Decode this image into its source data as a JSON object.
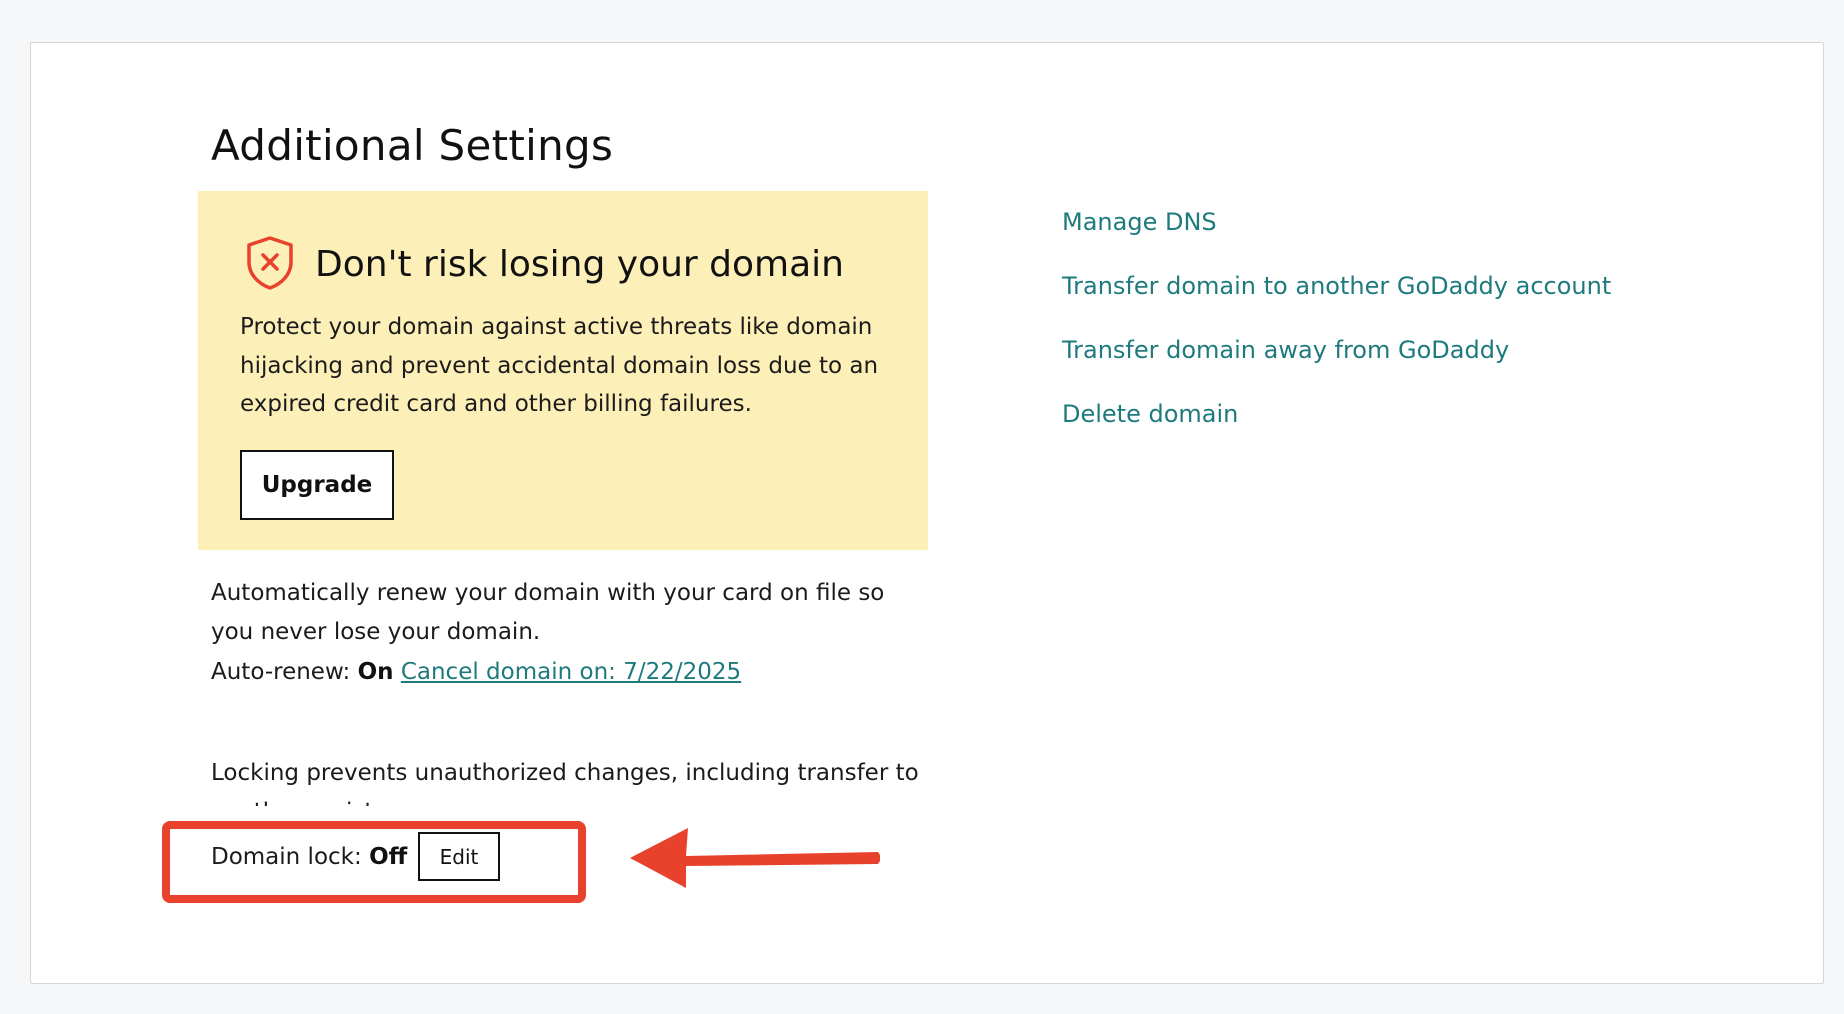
{
  "page": {
    "title": "Additional Settings"
  },
  "promo": {
    "title": "Don't risk losing your domain",
    "text": "Protect your domain against active threats like domain hijacking and prevent accidental domain loss due to an expired credit card and other billing failures.",
    "button_label": "Upgrade",
    "icon": "shield-x-icon",
    "background_color": "#fdefb8",
    "icon_color": "#e8412c"
  },
  "auto_renew": {
    "description": "Automatically renew your domain with your card on file so you never lose your domain.",
    "label": "Auto-renew:",
    "status": "On",
    "cancel_link": "Cancel domain on: 7/22/2025"
  },
  "domain_lock": {
    "description": "Locking prevents unauthorized changes, including transfer to another registrar.",
    "label": "Domain lock:",
    "status": "Off",
    "edit_label": "Edit"
  },
  "side_links": {
    "items": [
      {
        "label": "Manage DNS"
      },
      {
        "label": "Transfer domain to another GoDaddy account"
      },
      {
        "label": "Transfer domain away from GoDaddy"
      },
      {
        "label": "Delete domain"
      }
    ]
  },
  "colors": {
    "link": "#1f7a7d",
    "annotation": "#e8412c",
    "page_background": "#f5f7f8"
  }
}
